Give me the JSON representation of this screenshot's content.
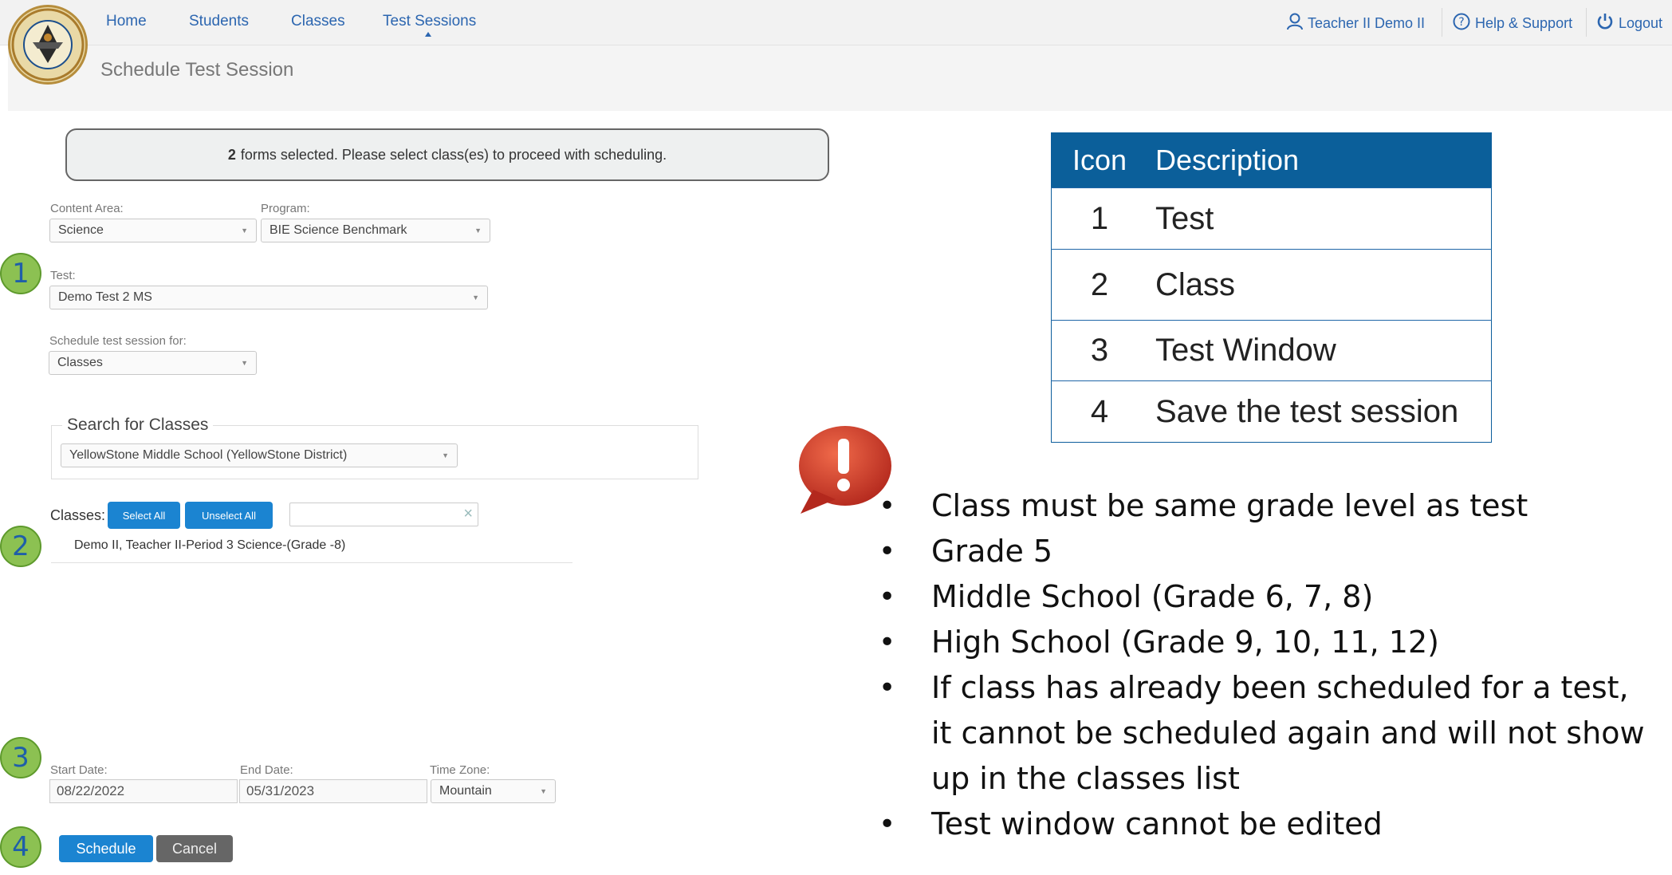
{
  "header": {
    "nav": [
      "Home",
      "Students",
      "Classes",
      "Test Sessions"
    ],
    "user": "Teacher II Demo II",
    "help": "Help & Support",
    "logout": "Logout",
    "page_title": "Schedule Test Session"
  },
  "message": {
    "count": "2",
    "text": "forms selected. Please select class(es) to proceed with scheduling."
  },
  "form": {
    "content_area_label": "Content Area:",
    "content_area_value": "Science",
    "program_label": "Program:",
    "program_value": "BIE Science Benchmark",
    "test_label": "Test:",
    "test_value": "Demo Test 2 MS",
    "schedule_for_label": "Schedule test session for:",
    "schedule_for_value": "Classes",
    "search_legend": "Search for Classes",
    "school_value": "YellowStone Middle School (YellowStone District)",
    "classes_label": "Classes:",
    "select_all": "Select All",
    "unselect_all": "Unselect All",
    "filter_clear": "×",
    "class_item": "Demo II, Teacher II-Period 3 Science-(Grade -8)",
    "start_label": "Start Date:",
    "start_value": "08/22/2022",
    "end_label": "End Date:",
    "end_value": "05/31/2023",
    "tz_label": "Time Zone:",
    "tz_value": "Mountain",
    "schedule_btn": "Schedule",
    "cancel_btn": "Cancel"
  },
  "markers": [
    "1",
    "2",
    "3",
    "4"
  ],
  "legend_table": {
    "headers": [
      "Icon",
      "Description"
    ],
    "rows": [
      {
        "icon": "1",
        "desc": "Test"
      },
      {
        "icon": "2",
        "desc": "Class"
      },
      {
        "icon": "3",
        "desc": "Test Window"
      },
      {
        "icon": "4",
        "desc": "Save the test session"
      }
    ]
  },
  "callout": {
    "icon": "!",
    "bullets": [
      "Class must be same grade level as test",
      "Grade 5",
      "Middle School (Grade 6, 7, 8)",
      "High School (Grade 9, 10, 11, 12)",
      "If class has already been scheduled for a test, it cannot be scheduled again and will not show up in the classes list",
      "Test window cannot be edited"
    ]
  },
  "colors": {
    "accent": "#1b84d1",
    "header_blue": "#0b5f9a",
    "marker_green": "#8cc152",
    "alert_red": "#c9352a"
  }
}
